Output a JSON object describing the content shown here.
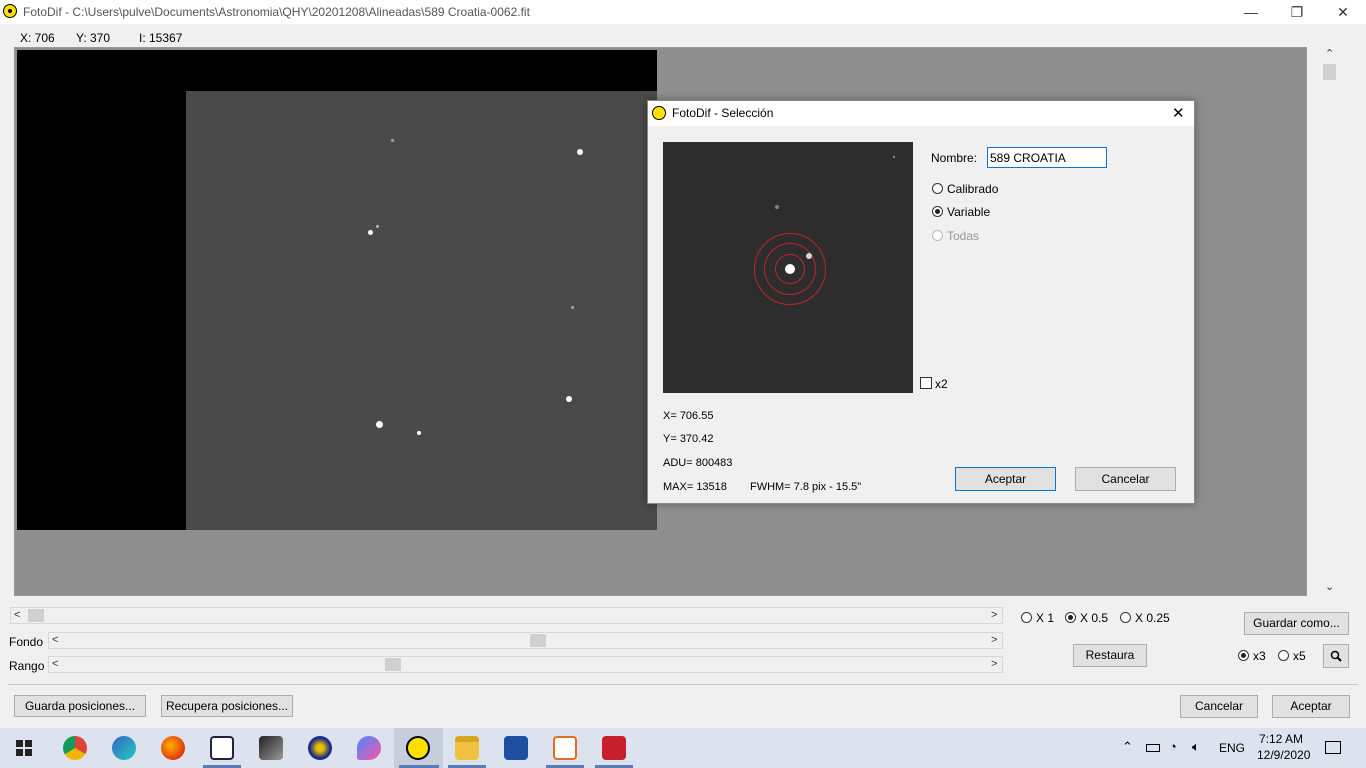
{
  "window": {
    "title": "FotoDif - C:\\Users\\pulve\\Documents\\Astronomia\\QHY\\20201208\\Alineadas\\589 Croatia-0062.fit",
    "minimize": "—",
    "restore": "❐",
    "close": "✕"
  },
  "coords": {
    "x": "X: 706",
    "y": "Y: 370",
    "i": "I: 15367"
  },
  "sliders": {
    "fondo_label": "Fondo",
    "rango_label": "Rango",
    "fondo_value": 0.51,
    "rango_value": 0.35,
    "hscroll_value": 0.0
  },
  "zoom": {
    "options": [
      "X 1",
      "X 0.5",
      "X 0.25"
    ],
    "selected": "X 0.5"
  },
  "magnifier": {
    "options": [
      "x3",
      "x5"
    ],
    "selected": "x3"
  },
  "buttons": {
    "guardar_como": "Guardar como...",
    "restaura": "Restaura",
    "guarda_posiciones": "Guarda posiciones...",
    "recupera_posiciones": "Recupera posiciones...",
    "cancelar": "Cancelar",
    "aceptar": "Aceptar"
  },
  "dialog": {
    "title": "FotoDif - Selección",
    "close": "✕",
    "nombre_label": "Nombre:",
    "nombre_value": "589 CROATIA",
    "radios": [
      "Calibrado",
      "Variable",
      "Todas"
    ],
    "selected": "Variable",
    "x2_label": "x2",
    "x": "X= 706.55",
    "y": "Y= 370.42",
    "adu": "ADU= 800483",
    "max": "MAX= 13518",
    "fwhm": "FWHM= 7.8 pix - 15.5\"",
    "aceptar": "Aceptar",
    "cancelar": "Cancelar"
  },
  "taskbar": {
    "apps": [
      "windows-start-icon",
      "chrome-icon",
      "edge-icon",
      "firefox-icon",
      "app-icon-1",
      "app-icon-2",
      "app-icon-3",
      "app-icon-4",
      "fotodif-icon",
      "file-explorer-icon",
      "save-app-icon",
      "java-icon",
      "camera-app-icon"
    ],
    "language": "ENG",
    "time": "7:12 AM",
    "date": "12/9/2020"
  },
  "colors": {
    "accent": "#0078d7",
    "ring": "#c0242a",
    "app_yellow": "#ffe000"
  }
}
